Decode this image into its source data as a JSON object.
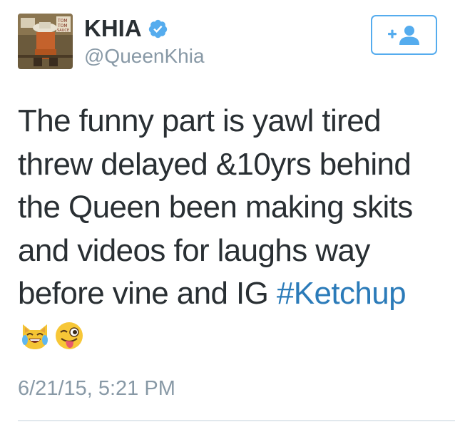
{
  "user": {
    "display_name": "KHIA",
    "handle": "@QueenKhia",
    "verified": true,
    "avatar_icon": "profile-photo"
  },
  "follow_button": {
    "icon": "add-user-icon",
    "symbol": "+",
    "color": "#55acee"
  },
  "tweet": {
    "lines": [
      "The funny part is yawl tired",
      "threw delayed &10yrs behind",
      "the Queen been making skits",
      "and videos for laughs way",
      "before vine and IG "
    ],
    "hashtag": "#Ketchup",
    "emojis": [
      "joy-cat-emoji",
      "winking-tongue-emoji"
    ],
    "timestamp": "6/21/15, 5:21 PM"
  },
  "colors": {
    "text": "#292f33",
    "secondary": "#8899a6",
    "link": "#2b7bb9",
    "accent": "#55acee",
    "divider": "#e1e8ed"
  }
}
